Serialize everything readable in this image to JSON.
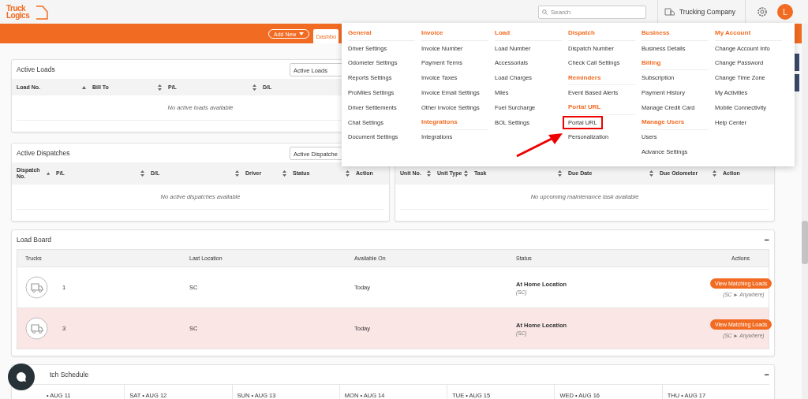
{
  "header": {
    "logo": {
      "line1": "Truck",
      "line2": "Logics"
    },
    "search": {
      "placeholder": "Search"
    },
    "company": "Trucking Company",
    "avatar": "L"
  },
  "navbar": {
    "add_new": "Add New",
    "tab": "Dashbo"
  },
  "active_loads": {
    "title": "Active Loads",
    "filter": "Active Loads",
    "columns": [
      {
        "label": "Load No.",
        "sortable": true,
        "sorted": true
      },
      {
        "label": "Bill To",
        "sortable": true,
        "sorted": false
      },
      {
        "label": "P/L",
        "sortable": true,
        "sorted": false
      },
      {
        "label": "D/L",
        "sortable": false,
        "sorted": false
      }
    ],
    "empty": "No active loads available"
  },
  "active_dispatches": {
    "title": "Active Dispatches",
    "filter": "Active Dispatche",
    "columns": [
      {
        "label": "Dispatch No.",
        "sortable": true,
        "sorted": true
      },
      {
        "label": "P/L",
        "sortable": true,
        "sorted": false
      },
      {
        "label": "D/L",
        "sortable": true,
        "sorted": false
      },
      {
        "label": "Driver",
        "sortable": true,
        "sorted": false
      },
      {
        "label": "Status",
        "sortable": true,
        "sorted": false
      },
      {
        "label": "Action",
        "sortable": false,
        "sorted": false
      }
    ],
    "empty": "No active dispatches available"
  },
  "maintenance": {
    "columns": [
      {
        "label": "Unit No.",
        "sortable": true,
        "sorted": false
      },
      {
        "label": "Unit Type",
        "sortable": true,
        "sorted": false
      },
      {
        "label": "Task",
        "sortable": true,
        "sorted": false
      },
      {
        "label": "Due Date",
        "sortable": true,
        "sorted": false
      },
      {
        "label": "Due Odometer",
        "sortable": true,
        "sorted": false
      },
      {
        "label": "Action",
        "sortable": false,
        "sorted": false
      }
    ],
    "empty": "No upcoming maintenance task available"
  },
  "load_board": {
    "title": "Load Board",
    "collapse": "−",
    "columns": [
      "Trucks",
      "Last Location",
      "Available On",
      "Status",
      "Actions"
    ],
    "rows": [
      {
        "truck": "1",
        "location": "SC",
        "available": "Today",
        "status": "At Home Location",
        "status_note": "(SC)",
        "action": "View Matching Loads",
        "route": "(SC ► Anywhere)",
        "highlighted": false
      },
      {
        "truck": "3",
        "location": "SC",
        "available": "Today",
        "status": "At Home Location",
        "status_note": "(SC)",
        "action": "View Matching Loads",
        "route": "(SC ► Anywhere)",
        "highlighted": true
      }
    ]
  },
  "dispatch_schedule": {
    "title": "tch Schedule",
    "collapse": "−",
    "days": [
      "• AUG 11",
      "SAT • AUG 12",
      "SUN • AUG 13",
      "MON • AUG 14",
      "TUE • AUG 15",
      "WED • AUG 16",
      "THU • AUG 17"
    ]
  },
  "settings_menu": {
    "columns": [
      {
        "sections": [
          {
            "heading": "General",
            "items": [
              {
                "label": "Driver Settings",
                "marked": false
              },
              {
                "label": "Odometer Settings",
                "marked": false
              },
              {
                "label": "Reports Settings",
                "marked": false
              },
              {
                "label": "ProMiles Settings",
                "marked": false
              },
              {
                "label": "Driver Settlements",
                "marked": false
              },
              {
                "label": "Chat Settings",
                "marked": false
              },
              {
                "label": "Document Settings",
                "marked": false
              }
            ]
          }
        ]
      },
      {
        "sections": [
          {
            "heading": "Invoice",
            "items": [
              {
                "label": "Invoice Number",
                "marked": false
              },
              {
                "label": "Payment Terms",
                "marked": false
              },
              {
                "label": "Invoice Taxes",
                "marked": false
              },
              {
                "label": "Invoice Email Settings",
                "marked": false
              },
              {
                "label": "Other Invoice Settings",
                "marked": false
              }
            ]
          },
          {
            "heading": "Integrations",
            "items": [
              {
                "label": "Integrations",
                "marked": false
              }
            ]
          }
        ]
      },
      {
        "sections": [
          {
            "heading": "Load",
            "items": [
              {
                "label": "Load Number",
                "marked": false
              },
              {
                "label": "Accessorials",
                "marked": false
              },
              {
                "label": "Load Charges",
                "marked": false
              },
              {
                "label": "Miles",
                "marked": false
              },
              {
                "label": "Fuel Surcharge",
                "marked": false
              },
              {
                "label": "BOL Settings",
                "marked": false
              }
            ]
          }
        ]
      },
      {
        "sections": [
          {
            "heading": "Dispatch",
            "items": [
              {
                "label": "Dispatch Number",
                "marked": false
              },
              {
                "label": "Check Call Settings",
                "marked": false
              }
            ]
          },
          {
            "heading": "Reminders",
            "items": [
              {
                "label": "Event Based Alerts",
                "marked": false
              }
            ]
          },
          {
            "heading": "Portal URL",
            "items": [
              {
                "label": "Portal URL",
                "marked": true
              },
              {
                "label": "Personalization",
                "marked": false
              }
            ]
          }
        ]
      },
      {
        "sections": [
          {
            "heading": "Business",
            "items": [
              {
                "label": "Business Details",
                "marked": false
              }
            ]
          },
          {
            "heading": "Billing",
            "items": [
              {
                "label": "Subscription",
                "marked": false
              },
              {
                "label": "Payment History",
                "marked": false
              },
              {
                "label": "Manage Credit Card",
                "marked": false
              }
            ]
          },
          {
            "heading": "Manage Users",
            "items": [
              {
                "label": "Users",
                "marked": false
              },
              {
                "label": "Advance Settings",
                "marked": false
              }
            ]
          }
        ]
      },
      {
        "sections": [
          {
            "heading": "My Account",
            "items": [
              {
                "label": "Change Account Info",
                "marked": false
              },
              {
                "label": "Change Password",
                "marked": false
              },
              {
                "label": "Change Time Zone",
                "marked": false
              },
              {
                "label": "My Activities",
                "marked": false
              },
              {
                "label": "Mobile Connectivity",
                "marked": false
              },
              {
                "label": "Help Center",
                "marked": false
              }
            ]
          }
        ]
      }
    ]
  }
}
